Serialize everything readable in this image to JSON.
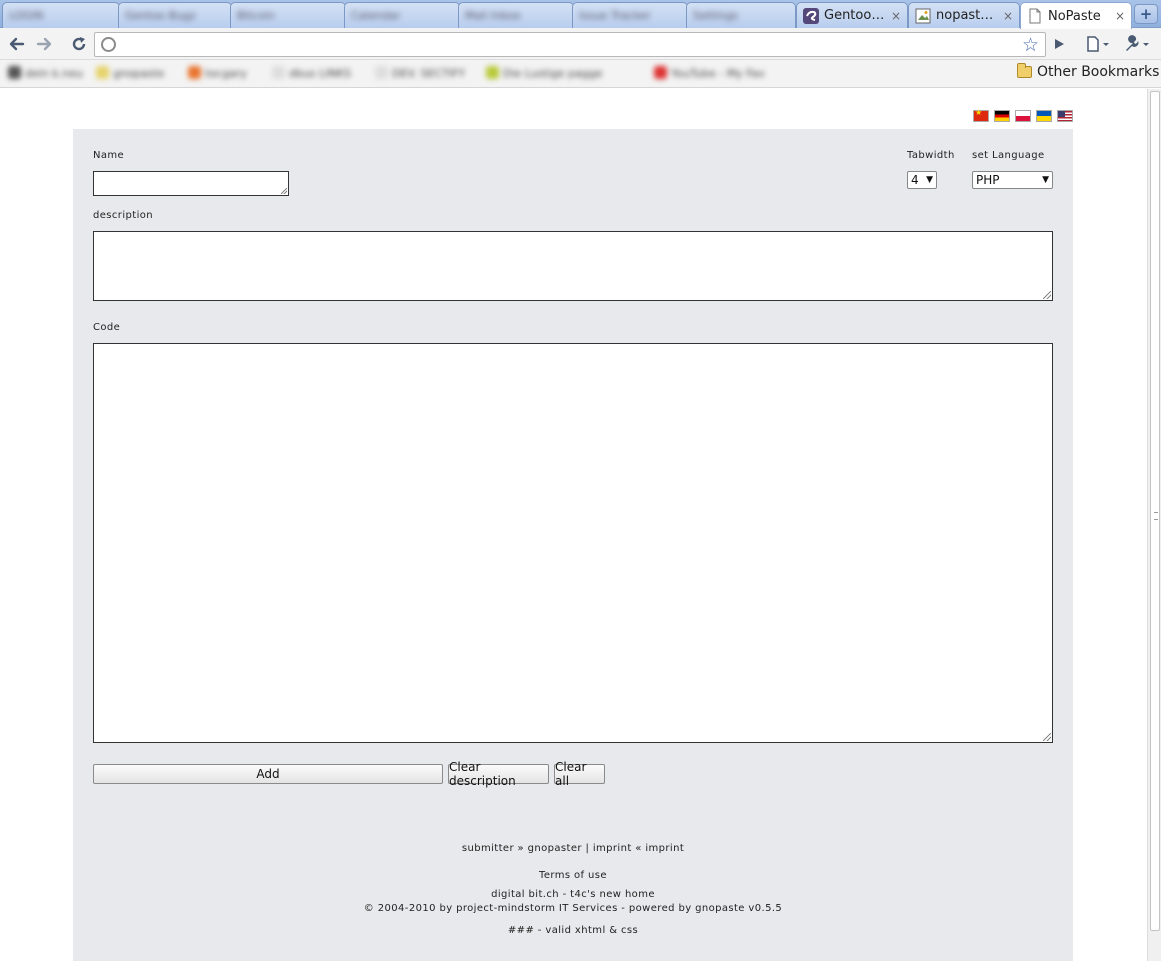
{
  "browser": {
    "tabs": [
      {
        "title": "",
        "blurred": true,
        "blur_label": "LOGIN"
      },
      {
        "title": "",
        "blurred": true,
        "blur_label": "Gentoo Bugz"
      },
      {
        "title": "",
        "blurred": true,
        "blur_label": "Bitcoin"
      },
      {
        "title": "",
        "blurred": true,
        "blur_label": "Calendar"
      },
      {
        "title": "",
        "blurred": true,
        "blur_label": "Mail Inbox"
      },
      {
        "title": "",
        "blurred": true,
        "blur_label": "Issue Tracker"
      },
      {
        "title": "",
        "blurred": true,
        "blur_label": "Settings"
      },
      {
        "title": "Gentoo …",
        "blurred": false
      },
      {
        "title": "nopaste…",
        "blurred": false
      },
      {
        "title": "NoPaste",
        "blurred": false,
        "active": true
      }
    ],
    "new_tab_symbol": "+",
    "close_symbol": "×",
    "address": "",
    "other_bookmarks": "Other Bookmarks",
    "bookmarks": [
      "dein k.neu",
      "gnopaste",
      "tocgary",
      "dbus LINKS",
      "DEV. SECTIFY",
      "Die Lustige pagge",
      "YouTube - My Fav"
    ]
  },
  "page": {
    "languages": [
      "zh",
      "de",
      "pl",
      "uk",
      "en-us"
    ],
    "form": {
      "name_label": "Name",
      "name_value": "",
      "tabwidth_label": "Tabwidth",
      "tabwidth_value": "4",
      "language_label": "set Language",
      "language_value": "PHP",
      "description_label": "description",
      "description_value": "",
      "code_label": "Code",
      "code_value": "",
      "add_button": "Add",
      "clear_description_button": "Clear description",
      "clear_all_button": "Clear all"
    },
    "footer": {
      "line1": "submitter » gnopaster | imprint « imprint",
      "line2": "Terms of use",
      "line3": "digital bit.ch - t4c's new home",
      "line4": "© 2004-2010 by project-mindstorm IT Services - powered by gnopaste v0.5.5",
      "line5": "### - valid xhtml & css"
    }
  }
}
